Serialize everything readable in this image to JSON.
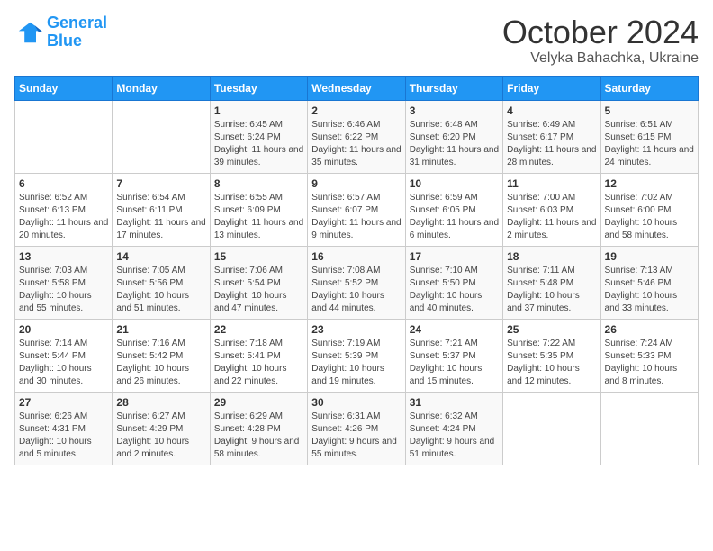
{
  "logo": {
    "line1": "General",
    "line2": "Blue"
  },
  "title": "October 2024",
  "subtitle": "Velyka Bahachka, Ukraine",
  "days_of_week": [
    "Sunday",
    "Monday",
    "Tuesday",
    "Wednesday",
    "Thursday",
    "Friday",
    "Saturday"
  ],
  "weeks": [
    [
      {
        "day": "",
        "info": ""
      },
      {
        "day": "",
        "info": ""
      },
      {
        "day": "1",
        "info": "Sunrise: 6:45 AM\nSunset: 6:24 PM\nDaylight: 11 hours and 39 minutes."
      },
      {
        "day": "2",
        "info": "Sunrise: 6:46 AM\nSunset: 6:22 PM\nDaylight: 11 hours and 35 minutes."
      },
      {
        "day": "3",
        "info": "Sunrise: 6:48 AM\nSunset: 6:20 PM\nDaylight: 11 hours and 31 minutes."
      },
      {
        "day": "4",
        "info": "Sunrise: 6:49 AM\nSunset: 6:17 PM\nDaylight: 11 hours and 28 minutes."
      },
      {
        "day": "5",
        "info": "Sunrise: 6:51 AM\nSunset: 6:15 PM\nDaylight: 11 hours and 24 minutes."
      }
    ],
    [
      {
        "day": "6",
        "info": "Sunrise: 6:52 AM\nSunset: 6:13 PM\nDaylight: 11 hours and 20 minutes."
      },
      {
        "day": "7",
        "info": "Sunrise: 6:54 AM\nSunset: 6:11 PM\nDaylight: 11 hours and 17 minutes."
      },
      {
        "day": "8",
        "info": "Sunrise: 6:55 AM\nSunset: 6:09 PM\nDaylight: 11 hours and 13 minutes."
      },
      {
        "day": "9",
        "info": "Sunrise: 6:57 AM\nSunset: 6:07 PM\nDaylight: 11 hours and 9 minutes."
      },
      {
        "day": "10",
        "info": "Sunrise: 6:59 AM\nSunset: 6:05 PM\nDaylight: 11 hours and 6 minutes."
      },
      {
        "day": "11",
        "info": "Sunrise: 7:00 AM\nSunset: 6:03 PM\nDaylight: 11 hours and 2 minutes."
      },
      {
        "day": "12",
        "info": "Sunrise: 7:02 AM\nSunset: 6:00 PM\nDaylight: 10 hours and 58 minutes."
      }
    ],
    [
      {
        "day": "13",
        "info": "Sunrise: 7:03 AM\nSunset: 5:58 PM\nDaylight: 10 hours and 55 minutes."
      },
      {
        "day": "14",
        "info": "Sunrise: 7:05 AM\nSunset: 5:56 PM\nDaylight: 10 hours and 51 minutes."
      },
      {
        "day": "15",
        "info": "Sunrise: 7:06 AM\nSunset: 5:54 PM\nDaylight: 10 hours and 47 minutes."
      },
      {
        "day": "16",
        "info": "Sunrise: 7:08 AM\nSunset: 5:52 PM\nDaylight: 10 hours and 44 minutes."
      },
      {
        "day": "17",
        "info": "Sunrise: 7:10 AM\nSunset: 5:50 PM\nDaylight: 10 hours and 40 minutes."
      },
      {
        "day": "18",
        "info": "Sunrise: 7:11 AM\nSunset: 5:48 PM\nDaylight: 10 hours and 37 minutes."
      },
      {
        "day": "19",
        "info": "Sunrise: 7:13 AM\nSunset: 5:46 PM\nDaylight: 10 hours and 33 minutes."
      }
    ],
    [
      {
        "day": "20",
        "info": "Sunrise: 7:14 AM\nSunset: 5:44 PM\nDaylight: 10 hours and 30 minutes."
      },
      {
        "day": "21",
        "info": "Sunrise: 7:16 AM\nSunset: 5:42 PM\nDaylight: 10 hours and 26 minutes."
      },
      {
        "day": "22",
        "info": "Sunrise: 7:18 AM\nSunset: 5:41 PM\nDaylight: 10 hours and 22 minutes."
      },
      {
        "day": "23",
        "info": "Sunrise: 7:19 AM\nSunset: 5:39 PM\nDaylight: 10 hours and 19 minutes."
      },
      {
        "day": "24",
        "info": "Sunrise: 7:21 AM\nSunset: 5:37 PM\nDaylight: 10 hours and 15 minutes."
      },
      {
        "day": "25",
        "info": "Sunrise: 7:22 AM\nSunset: 5:35 PM\nDaylight: 10 hours and 12 minutes."
      },
      {
        "day": "26",
        "info": "Sunrise: 7:24 AM\nSunset: 5:33 PM\nDaylight: 10 hours and 8 minutes."
      }
    ],
    [
      {
        "day": "27",
        "info": "Sunrise: 6:26 AM\nSunset: 4:31 PM\nDaylight: 10 hours and 5 minutes."
      },
      {
        "day": "28",
        "info": "Sunrise: 6:27 AM\nSunset: 4:29 PM\nDaylight: 10 hours and 2 minutes."
      },
      {
        "day": "29",
        "info": "Sunrise: 6:29 AM\nSunset: 4:28 PM\nDaylight: 9 hours and 58 minutes."
      },
      {
        "day": "30",
        "info": "Sunrise: 6:31 AM\nSunset: 4:26 PM\nDaylight: 9 hours and 55 minutes."
      },
      {
        "day": "31",
        "info": "Sunrise: 6:32 AM\nSunset: 4:24 PM\nDaylight: 9 hours and 51 minutes."
      },
      {
        "day": "",
        "info": ""
      },
      {
        "day": "",
        "info": ""
      }
    ]
  ]
}
